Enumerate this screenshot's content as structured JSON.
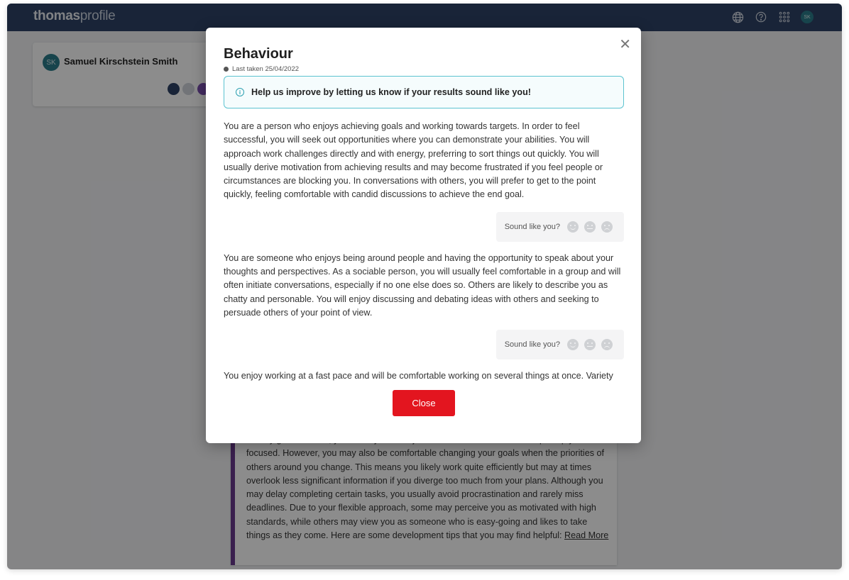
{
  "app": {
    "logo_bold": "thomas",
    "logo_light": "profile",
    "user_initials": "SK"
  },
  "profile_card": {
    "initials": "SK",
    "name": "Samuel Kirschstein Smith"
  },
  "background_text": {
    "text": "is fairly goal-oriented, you usually have objectives to work towards that help keep you focused. However, you may also be comfortable changing your goals when the priorities of others around you change. This means you likely work quite efficiently but may at times overlook less significant information if you diverge too much from your plans. Although you may delay completing certain tasks, you usually avoid procrastination and rarely miss deadlines. Due to your flexible approach, some may perceive you as motivated with high standards, while others may view you as someone who is easy-going and likes to take things as they come. Here are some development tips that you may find helpful: ",
    "link": "Read More"
  },
  "modal": {
    "title": "Behaviour",
    "last_taken": "Last taken 25/04/2022",
    "banner": "Help us improve by letting us know if your results sound like you!",
    "paragraphs": [
      "You are a person who enjoys achieving goals and working towards targets. In order to feel successful, you will seek out opportunities where you can demonstrate your abilities. You will approach work challenges directly and with energy, preferring to sort things out quickly. You will usually derive motivation from achieving results and may become frustrated if you feel people or circumstances are blocking you. In conversations with others, you will prefer to get to the point quickly, feeling comfortable with candid discussions to achieve the end goal.",
      "You are someone who enjoys being around people and having the opportunity to speak about your thoughts and perspectives. As a sociable person, you will usually feel comfortable in a group and will often initiate conversations, especially if no one else does so. Others are likely to describe you as chatty and personable. You will enjoy discussing and debating ideas with others and seeking to persuade others of your point of view.",
      "You enjoy working at a fast pace and will be comfortable working on several things at once. Variety will keep you engaged, whereas slow or repetitive tasks will see you lose interest quite quickly. As"
    ],
    "feedback_label": "Sound like you?",
    "close_label": "Close"
  }
}
